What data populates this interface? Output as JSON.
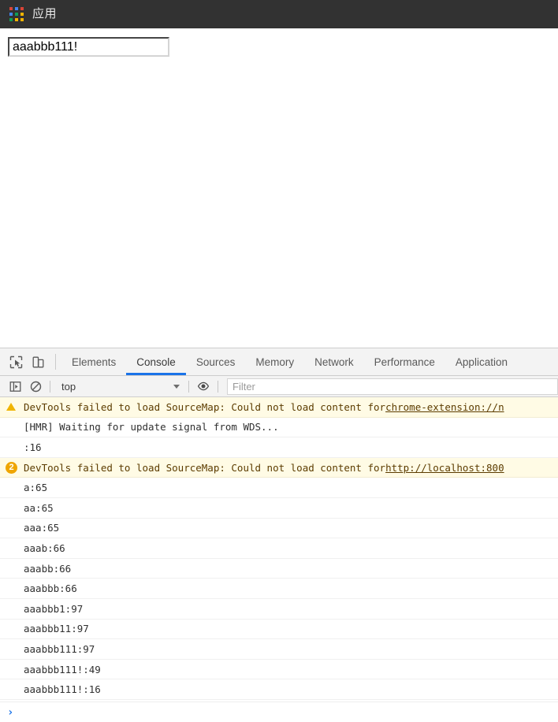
{
  "browser_bar": {
    "apps_icon": "apps-grid-icon",
    "apps_label": "应用",
    "grid_colors": [
      "#db4437",
      "#4285f4",
      "#db4437",
      "#4285f4",
      "#0f9d58",
      "#f4b400",
      "#0f9d58",
      "#f4b400",
      "#f4b400"
    ]
  },
  "page": {
    "input_value": "aaabbb111!",
    "input_placeholder": ""
  },
  "devtools": {
    "accent_color": "#1a73e8",
    "tabs": [
      {
        "label": "Elements",
        "active": false
      },
      {
        "label": "Console",
        "active": true
      },
      {
        "label": "Sources",
        "active": false
      },
      {
        "label": "Memory",
        "active": false
      },
      {
        "label": "Network",
        "active": false
      },
      {
        "label": "Performance",
        "active": false
      },
      {
        "label": "Application",
        "active": false
      }
    ],
    "toolbar_icons": {
      "inspect": "inspect-element-icon",
      "device": "device-toolbar-icon"
    },
    "console_toolbar": {
      "sidebar_icon": "console-sidebar-icon",
      "clear_icon": "clear-console-icon",
      "context": "top",
      "eye_icon": "live-expression-icon",
      "filter_placeholder": "Filter"
    },
    "messages": [
      {
        "level": "warning",
        "badge": "warning-triangle-icon",
        "count": null,
        "text": "DevTools failed to load SourceMap: Could not load content for ",
        "link": "chrome-extension://n"
      },
      {
        "level": "log",
        "badge": null,
        "count": null,
        "text": "[HMR] Waiting for update signal from WDS...",
        "link": ""
      },
      {
        "level": "log",
        "badge": null,
        "count": null,
        "text": ":16",
        "link": ""
      },
      {
        "level": "warning",
        "badge": "count-badge",
        "count": "2",
        "text": "DevTools failed to load SourceMap: Could not load content for ",
        "link": "http://localhost:800"
      },
      {
        "level": "log",
        "badge": null,
        "count": null,
        "text": "a:65",
        "link": ""
      },
      {
        "level": "log",
        "badge": null,
        "count": null,
        "text": "aa:65",
        "link": ""
      },
      {
        "level": "log",
        "badge": null,
        "count": null,
        "text": "aaa:65",
        "link": ""
      },
      {
        "level": "log",
        "badge": null,
        "count": null,
        "text": "aaab:66",
        "link": ""
      },
      {
        "level": "log",
        "badge": null,
        "count": null,
        "text": "aaabb:66",
        "link": ""
      },
      {
        "level": "log",
        "badge": null,
        "count": null,
        "text": "aaabbb:66",
        "link": ""
      },
      {
        "level": "log",
        "badge": null,
        "count": null,
        "text": "aaabbb1:97",
        "link": ""
      },
      {
        "level": "log",
        "badge": null,
        "count": null,
        "text": "aaabbb11:97",
        "link": ""
      },
      {
        "level": "log",
        "badge": null,
        "count": null,
        "text": "aaabbb111:97",
        "link": ""
      },
      {
        "level": "log",
        "badge": null,
        "count": null,
        "text": "aaabbb111!:49",
        "link": ""
      },
      {
        "level": "log",
        "badge": null,
        "count": null,
        "text": "aaabbb111!:16",
        "link": ""
      }
    ],
    "prompt": {
      "caret": "›",
      "value": ""
    }
  }
}
